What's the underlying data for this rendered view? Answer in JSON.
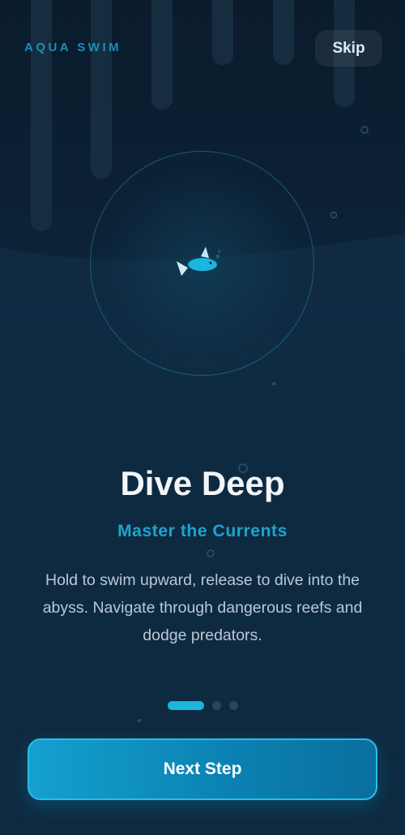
{
  "app": {
    "brand": "AQUA SWIM",
    "skip_label": "Skip"
  },
  "onboarding": {
    "title": "Dive Deep",
    "subtitle": "Master the Currents",
    "description": "Hold to swim upward, release to dive into the abyss. Navigate through dangerous reefs and dodge predators.",
    "page_count": 3,
    "current_page": 1
  },
  "actions": {
    "next_label": "Next Step"
  },
  "colors": {
    "accent": "#19b6dd",
    "brand": "#1a8fb6",
    "background": "#0c2236",
    "fish": "#1bb5e0"
  }
}
